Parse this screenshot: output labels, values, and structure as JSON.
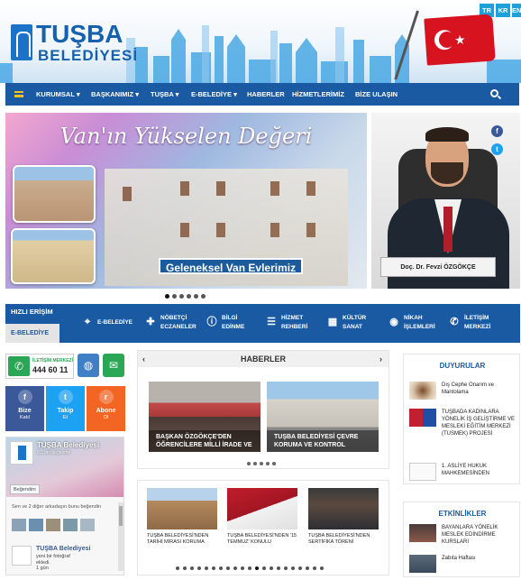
{
  "header": {
    "logo_main": "TUŞBA",
    "logo_sub": "BELEDİYESİ",
    "languages": [
      "TR",
      "KR",
      "EN"
    ]
  },
  "nav": {
    "items": [
      "KURUMSAL",
      "BAŞKANIMIZ",
      "TUŞBA",
      "E-BELEDİYE",
      "HABERLER",
      "HİZMETLERİMİZ",
      "BİZE ULAŞIN"
    ],
    "dropdown_marker": "▾"
  },
  "slider": {
    "title": "Van'ın Yükselen Değeri",
    "caption": "Geleneksel Van Evlerimiz"
  },
  "mayor": {
    "name": "Doç. Dr. Fevzi ÖZGÖKÇE"
  },
  "quick": {
    "title": "HIZLI ERİŞİM",
    "tab": "E-BELEDİYE",
    "items": [
      {
        "label": "E-BELEDİYE",
        "icon": "binoculars-icon"
      },
      {
        "label": "NÖBETÇİ\nECZANELER",
        "icon": "medkit-icon"
      },
      {
        "label": "BİLGİ\nEDİNME",
        "icon": "info-icon"
      },
      {
        "label": "HİZMET\nREHBERİ",
        "icon": "list-icon"
      },
      {
        "label": "KÜLTÜR\nSANAT",
        "icon": "film-icon"
      },
      {
        "label": "NİKAH\nİŞLEMLERİ",
        "icon": "ring-icon"
      },
      {
        "label": "İLETİŞİM\nMERKEZİ",
        "icon": "phone-icon"
      }
    ]
  },
  "contact": {
    "label": "İLETİŞİM MERKEZİ",
    "number": "444 60 11"
  },
  "follow": [
    {
      "label": "Bize",
      "sub": "Katıl",
      "color": "#3b5998",
      "icon": "f"
    },
    {
      "label": "Takip",
      "sub": "Et",
      "color": "#1da1f2",
      "icon": "t"
    },
    {
      "label": "Abone",
      "sub": "Ol",
      "color": "#f26522",
      "icon": "r"
    }
  ],
  "facebook": {
    "page_name": "TUŞBA Belediyesi",
    "likes": "8,5 bin beğenme",
    "like_button": "Beğendim",
    "friends": "Sen ve 2 diğer arkadaşın bunu beğendin",
    "post_name": "TUŞBA Belediyesi",
    "post_text": "yeni bir fotoğraf\nekledi.\n1 gün"
  },
  "news": {
    "title": "HABERLER",
    "prev": "‹",
    "next": "›",
    "cards": [
      {
        "title": "BAŞKAN ÖZGÖKÇE'DEN ÖĞRENCİLERE MİLLİ İRADE VE"
      },
      {
        "title": "TUŞBA BELEDİYESİ ÇEVRE KORUMA VE KONTROL"
      }
    ]
  },
  "news2": {
    "cards": [
      {
        "title": "TUŞBA BELEDİYESİ'NDEN TARİHİ MİRASI KORUMA"
      },
      {
        "title": "TUŞBA BELEDİYESİ'NDEN '15 TEMMUZ' KONULU"
      },
      {
        "title": "TUŞBA BELEDİYESİ'NDEN SERTİFİKA TÖRENİ"
      }
    ]
  },
  "announcements": {
    "title": "DUYURULAR",
    "items": [
      "Dış Cephe Onarım ve Mantolama",
      "TUŞBADA KADINLARA YÖNELİK İŞ GELİŞTİRME VE MESLEKİ EĞİTİM MERKEZİ (TUSMEK) PROJESİ",
      "1. ASLİYE HUKUK MAHKEMESİNDEN"
    ]
  },
  "events": {
    "title": "ETKİNLİKLER",
    "items": [
      "BAYANLARA YÖNELİK MESLEK EDİNDİRME KURSLARI",
      "Zabıta Haftası"
    ]
  },
  "colors": {
    "nav": "#1a5aa3",
    "accent": "#f0c419"
  }
}
